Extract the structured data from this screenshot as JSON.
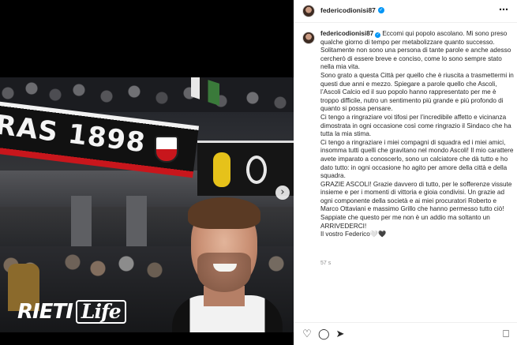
{
  "post": {
    "username": "federicodionisi87",
    "more_icon": "⋯",
    "verified_icon": "✓",
    "caption_paragraphs": [
      "Eccomi qui popolo ascolano. Mi sono preso qualche giorno di tempo per metabolizzare quanto successo. Solitamente non sono una persona di tante parole e anche adesso cercherò di essere breve e conciso, come lo sono sempre stato nella mia vita.",
      "Sono grato a questa Città per quello che è riuscita a trasmettermi in questi due anni e mezzo. Spiegare a parole quello che Ascoli, l’Ascoli Calcio ed il suo popolo hanno rappresentato per me è troppo difficile, nutro un sentimento più grande e più profondo di quanto si possa pensare.",
      "Ci tengo a ringraziare voi tifosi per l’incredibile affetto e vicinanza dimostrata in ogni occasione così come ringrazio il Sindaco che ha tutta la mia stima.",
      "Ci tengo a ringraziare i miei compagni di squadra ed i miei amici, insomma tutti quelli che gravitano nel mondo Ascoli! Il mio carattere avete imparato a conoscerlo, sono un calciatore che dà tutto e ho dato tutto: in ogni occasione ho agito per amore della città e della squadra.",
      "GRAZIE ASCOLI! Grazie davvero di tutto, per le sofferenze vissute insieme e per i momenti di vittoria e gioia condivisi. Un grazie ad ogni componente della società e ai miei procuratori Roberto e Marco Ottaviani e massimo Grillo che hanno permesso tutto ciò! Sappiate che questo per me non è un addio ma soltanto un ARRIVEDERCI!",
      "Il vostro Federico🤍🖤"
    ],
    "timestamp": "57 s"
  },
  "photo": {
    "banner_text": "RAS 1898",
    "watermark_main": "RIETI",
    "watermark_life": "Life",
    "next_icon": "›"
  },
  "actions": {
    "like_icon": "♡",
    "comment_icon": "◯",
    "share_icon": "➤",
    "save_icon": "⎕"
  }
}
